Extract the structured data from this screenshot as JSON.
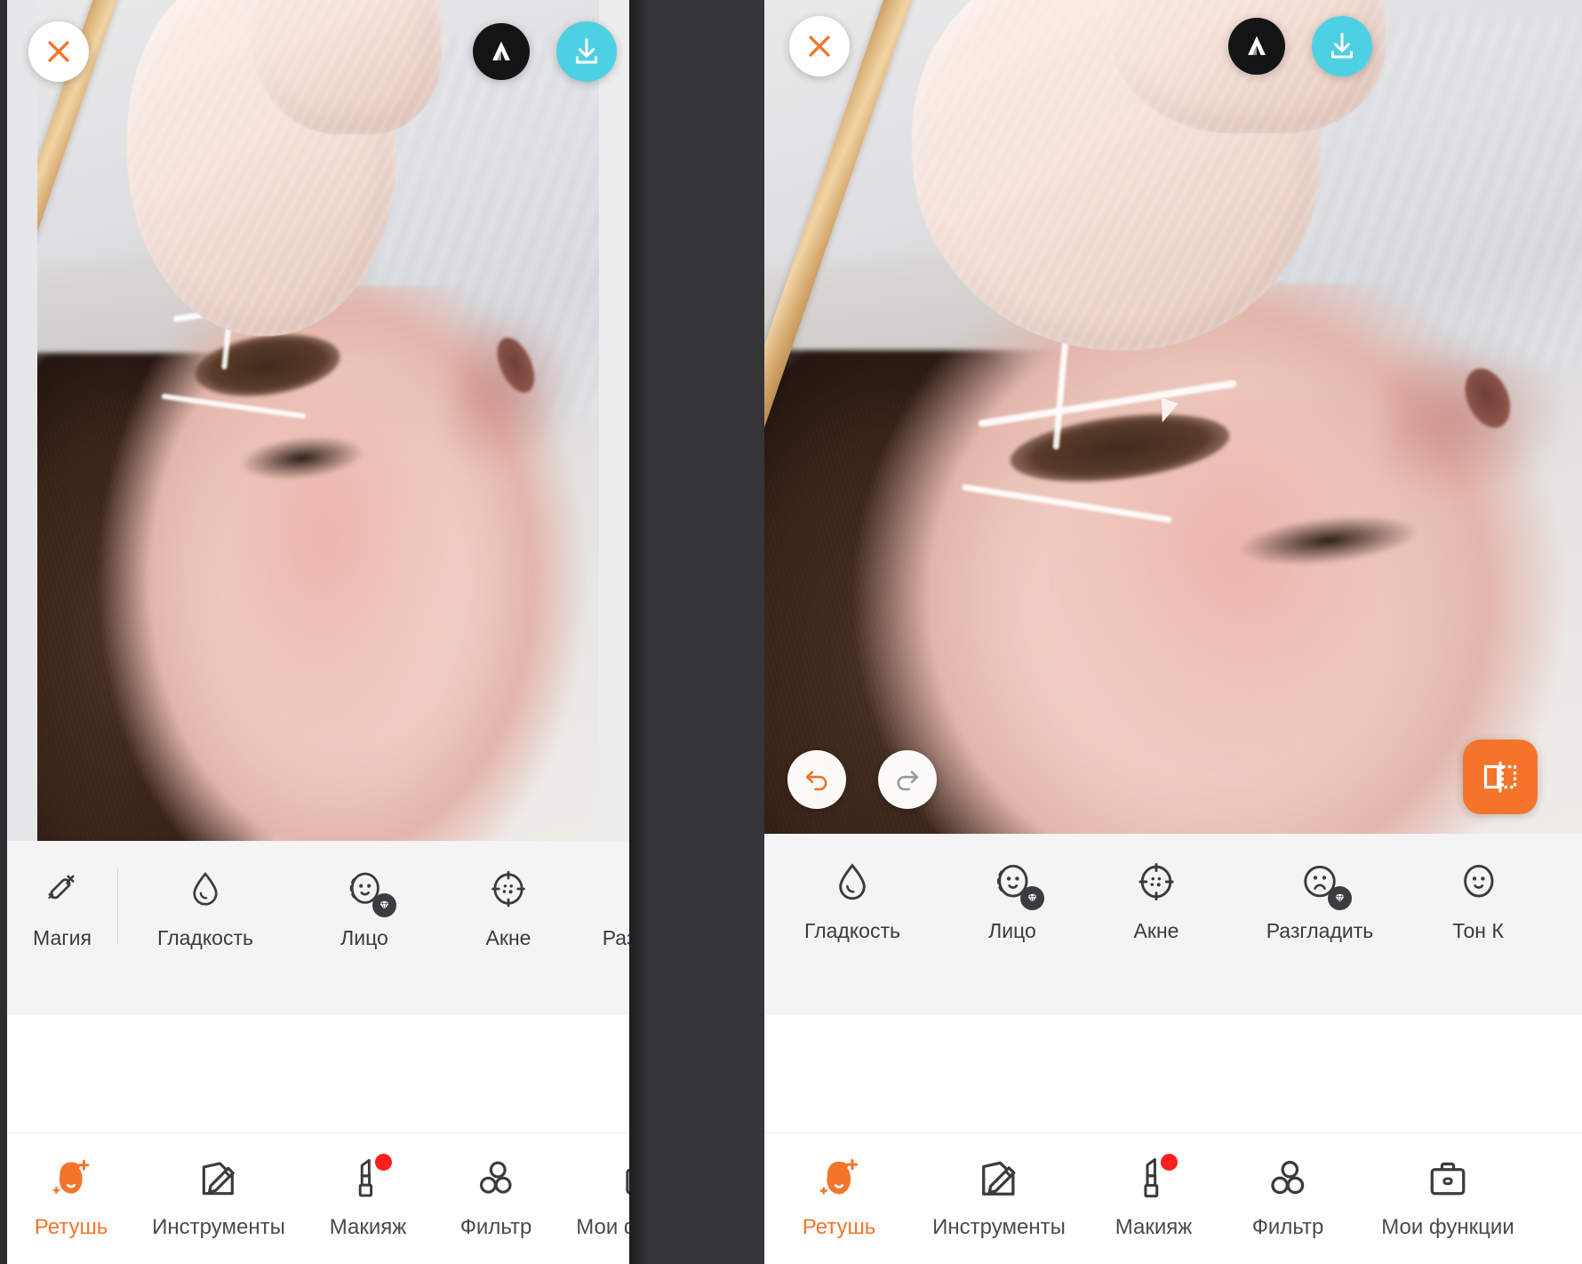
{
  "app": {
    "name": "AirBrush",
    "accent_color": "#f4742b",
    "download_color": "#4ed0e3",
    "badge_color": "#ff1f1f",
    "logo_icon": "airbrush-logo-icon"
  },
  "panels": [
    {
      "id": "left",
      "header": {
        "close_icon": "close-icon",
        "logo_icon": "airbrush-logo-icon",
        "download_icon": "download-icon"
      },
      "photo": {
        "alt": "Cosmetologist in latex gloves marking an eyebrow with a white pencil on a reclining woman",
        "visible": true
      },
      "tools": [
        {
          "label": "Магия",
          "icon": "magic-wand-icon",
          "badge": false,
          "separator_after": true
        },
        {
          "label": "Гладкость",
          "icon": "water-drop-icon",
          "badge": false
        },
        {
          "label": "Лицо",
          "icon": "face-smile-icon",
          "badge": true
        },
        {
          "label": "Акне",
          "icon": "acne-target-icon",
          "badge": false
        },
        {
          "label": "Разгладить",
          "icon": "face-wrinkle-icon",
          "badge": true
        }
      ],
      "nav": [
        {
          "label": "Ретушь",
          "icon": "retouch-face-icon",
          "active": true,
          "badge": false
        },
        {
          "label": "Инструменты",
          "icon": "tools-pencil-icon",
          "active": false,
          "badge": false
        },
        {
          "label": "Макияж",
          "icon": "lipstick-icon",
          "active": false,
          "badge": true
        },
        {
          "label": "Фильтр",
          "icon": "filter-circles-icon",
          "active": false,
          "badge": false
        },
        {
          "label": "Мои функции",
          "icon": "toolbox-icon",
          "active": false,
          "badge": false
        }
      ]
    },
    {
      "id": "right",
      "header": {
        "close_icon": "close-icon",
        "logo_icon": "airbrush-logo-icon",
        "download_icon": "download-icon"
      },
      "overlay_controls": {
        "undo_icon": "undo-arrow-icon",
        "redo_icon": "redo-arrow-icon",
        "compare_icon": "compare-split-icon",
        "undo_enabled": true,
        "redo_enabled": false
      },
      "photo": {
        "alt": "Zoomed view of the same eyebrow-marking photo",
        "visible": true
      },
      "tools": [
        {
          "label": "Гладкость",
          "icon": "water-drop-icon",
          "badge": false
        },
        {
          "label": "Лицо",
          "icon": "face-smile-icon",
          "badge": true
        },
        {
          "label": "Акне",
          "icon": "acne-target-icon",
          "badge": false
        },
        {
          "label": "Разгладить",
          "icon": "face-wrinkle-icon",
          "badge": true
        },
        {
          "label": "Тон К",
          "icon": "face-smile-icon",
          "badge": false
        }
      ],
      "nav": [
        {
          "label": "Ретушь",
          "icon": "retouch-face-icon",
          "active": true,
          "badge": false
        },
        {
          "label": "Инструменты",
          "icon": "tools-pencil-icon",
          "active": false,
          "badge": false
        },
        {
          "label": "Макияж",
          "icon": "lipstick-icon",
          "active": false,
          "badge": true
        },
        {
          "label": "Фильтр",
          "icon": "filter-circles-icon",
          "active": false,
          "badge": false
        },
        {
          "label": "Мои функции",
          "icon": "toolbox-icon",
          "active": false,
          "badge": false
        }
      ]
    }
  ]
}
